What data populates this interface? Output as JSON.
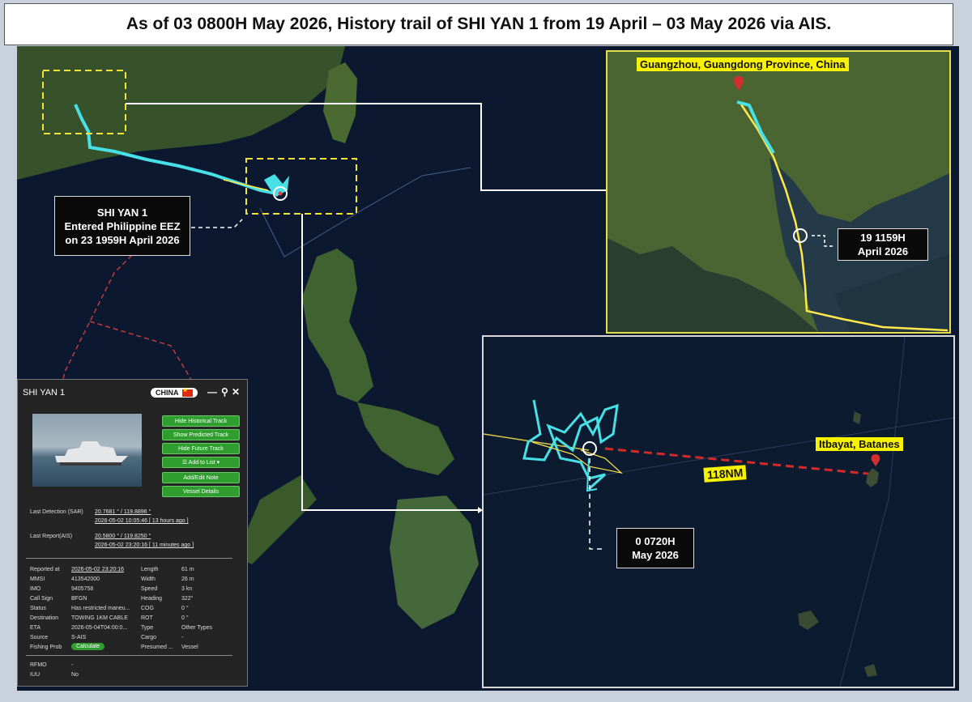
{
  "title": "As of 03 0800H May 2026, History trail of SHI YAN 1 from 19 April – 03 May 2026 via AIS.",
  "map": {
    "eez_callout": [
      "SHI YAN 1",
      "Entered Philippine EEZ",
      "on 23 1959H April 2026"
    ]
  },
  "inset_guangzhou": {
    "place_label": "Guangzhou, Guangdong Province, China",
    "time_callout": [
      "19 1159H",
      "April 2026"
    ]
  },
  "inset_batanes": {
    "place_label": "Itbayat, Batanes",
    "distance_label": "118NM",
    "time_callout": [
      "0 0720H",
      "May 2026"
    ]
  },
  "vessel_panel": {
    "name": "SHI YAN 1",
    "flag_label": "CHINA",
    "buttons": [
      "Hide Historical Track",
      "Show Predicted Track",
      "Hide Future Track",
      "☰ Add to List ▾",
      "Add/Edit Note",
      "Vessel Details"
    ],
    "last_detection_label": "Last Detection (SAR)",
    "last_detection_coords": "20.7681 ° / 119.8896 °",
    "last_detection_time": "2026-05-02 10:05:46 [ 13 hours ago ]",
    "last_report_label": "Last Report(AIS)",
    "last_report_coords": "20.5800 ° / 119.8250 °",
    "last_report_time": "2026-05-02 23:20:16 [ 11 minutes ago ]",
    "left_fields": [
      {
        "label": "Reported at",
        "value": "2026-05-02 23:20:16"
      },
      {
        "label": "MMSI",
        "value": "413542000"
      },
      {
        "label": "IMO",
        "value": "9405758"
      },
      {
        "label": "Call Sign",
        "value": "BFGN"
      },
      {
        "label": "Status",
        "value": "Has restricted maneu..."
      },
      {
        "label": "Destination",
        "value": "TOWING 1KM CABLE"
      },
      {
        "label": "ETA",
        "value": "2026-05-04T04:00:0..."
      },
      {
        "label": "Source",
        "value": "S-AIS"
      },
      {
        "label": "Fishing Prob",
        "value": ""
      }
    ],
    "right_fields": [
      {
        "label": "Length",
        "value": "61 m"
      },
      {
        "label": "Width",
        "value": "26 m"
      },
      {
        "label": "Speed",
        "value": "3 kn"
      },
      {
        "label": "Heading",
        "value": "322°"
      },
      {
        "label": "COG",
        "value": "0 °"
      },
      {
        "label": "ROT",
        "value": "0 °"
      },
      {
        "label": "Type",
        "value": "Other Types"
      },
      {
        "label": "Cargo",
        "value": "-"
      },
      {
        "label": "Presumed ...",
        "value": "Vessel"
      }
    ],
    "calculate_label": "Calculate",
    "bottom_fields": [
      {
        "label": "RFMO",
        "value": "-"
      },
      {
        "label": "IUU",
        "value": "No"
      }
    ]
  }
}
